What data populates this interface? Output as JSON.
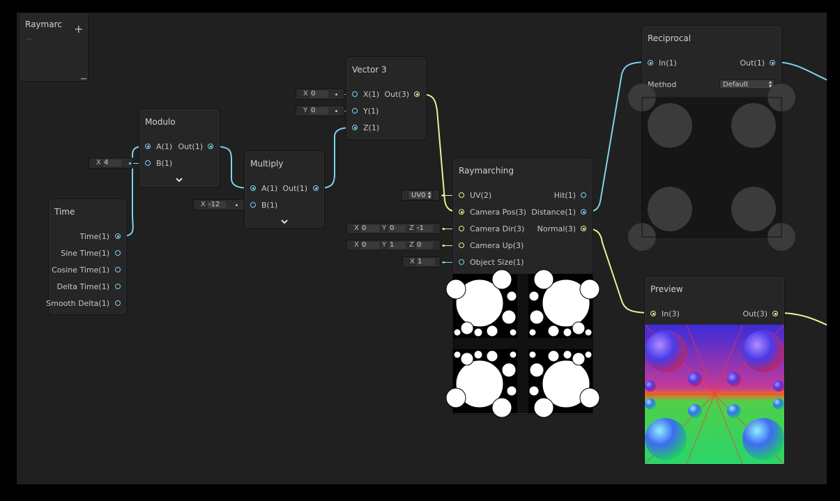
{
  "blackboard": {
    "title": "Raymarc",
    "add_label": "+",
    "minimize_label": "—"
  },
  "time": {
    "title": "Time",
    "outputs": [
      "Time(1)",
      "Sine Time(1)",
      "Cosine Time(1)",
      "Delta Time(1)",
      "Smooth Delta(1)"
    ]
  },
  "modulo": {
    "title": "Modulo",
    "in_a": "A(1)",
    "in_b": "B(1)",
    "out": "Out(1)",
    "b_field": {
      "label": "X",
      "value": "4"
    }
  },
  "multiply": {
    "title": "Multiply",
    "in_a": "A(1)",
    "in_b": "B(1)",
    "out": "Out(1)",
    "b_field": {
      "label": "X",
      "value": "-12"
    }
  },
  "vector3": {
    "title": "Vector 3",
    "in_x": "X(1)",
    "in_y": "Y(1)",
    "in_z": "Z(1)",
    "out": "Out(3)",
    "x_field": {
      "label": "X",
      "value": "0"
    },
    "y_field": {
      "label": "Y",
      "value": "0"
    }
  },
  "raymarching": {
    "title": "Raymarching",
    "uv": {
      "label": "UV(2)",
      "select": "UV0"
    },
    "camera_pos": "Camera Pos(3)",
    "camera_dir": {
      "label": "Camera Dir(3)",
      "x": "0",
      "y": "0",
      "z": "-1"
    },
    "camera_up": {
      "label": "Camera Up(3)",
      "x": "0",
      "y": "1",
      "z": "0"
    },
    "object_size": {
      "label": "Object Size(1)",
      "x": "1"
    },
    "out_hit": "Hit(1)",
    "out_distance": "Distance(1)",
    "out_normal": "Normal(3)"
  },
  "reciprocal": {
    "title": "Reciprocal",
    "in": "In(1)",
    "out": "Out(1)",
    "method_label": "Method",
    "method_value": "Default"
  },
  "preview": {
    "title": "Preview",
    "in": "In(3)",
    "out": "Out(3)"
  },
  "axis_labels": {
    "x": "X",
    "y": "Y",
    "z": "Z"
  },
  "colors": {
    "float_wire": "#7fd3ec",
    "vector_wire": "#f1ef96",
    "canvas": "#202020",
    "node": "#262626"
  }
}
